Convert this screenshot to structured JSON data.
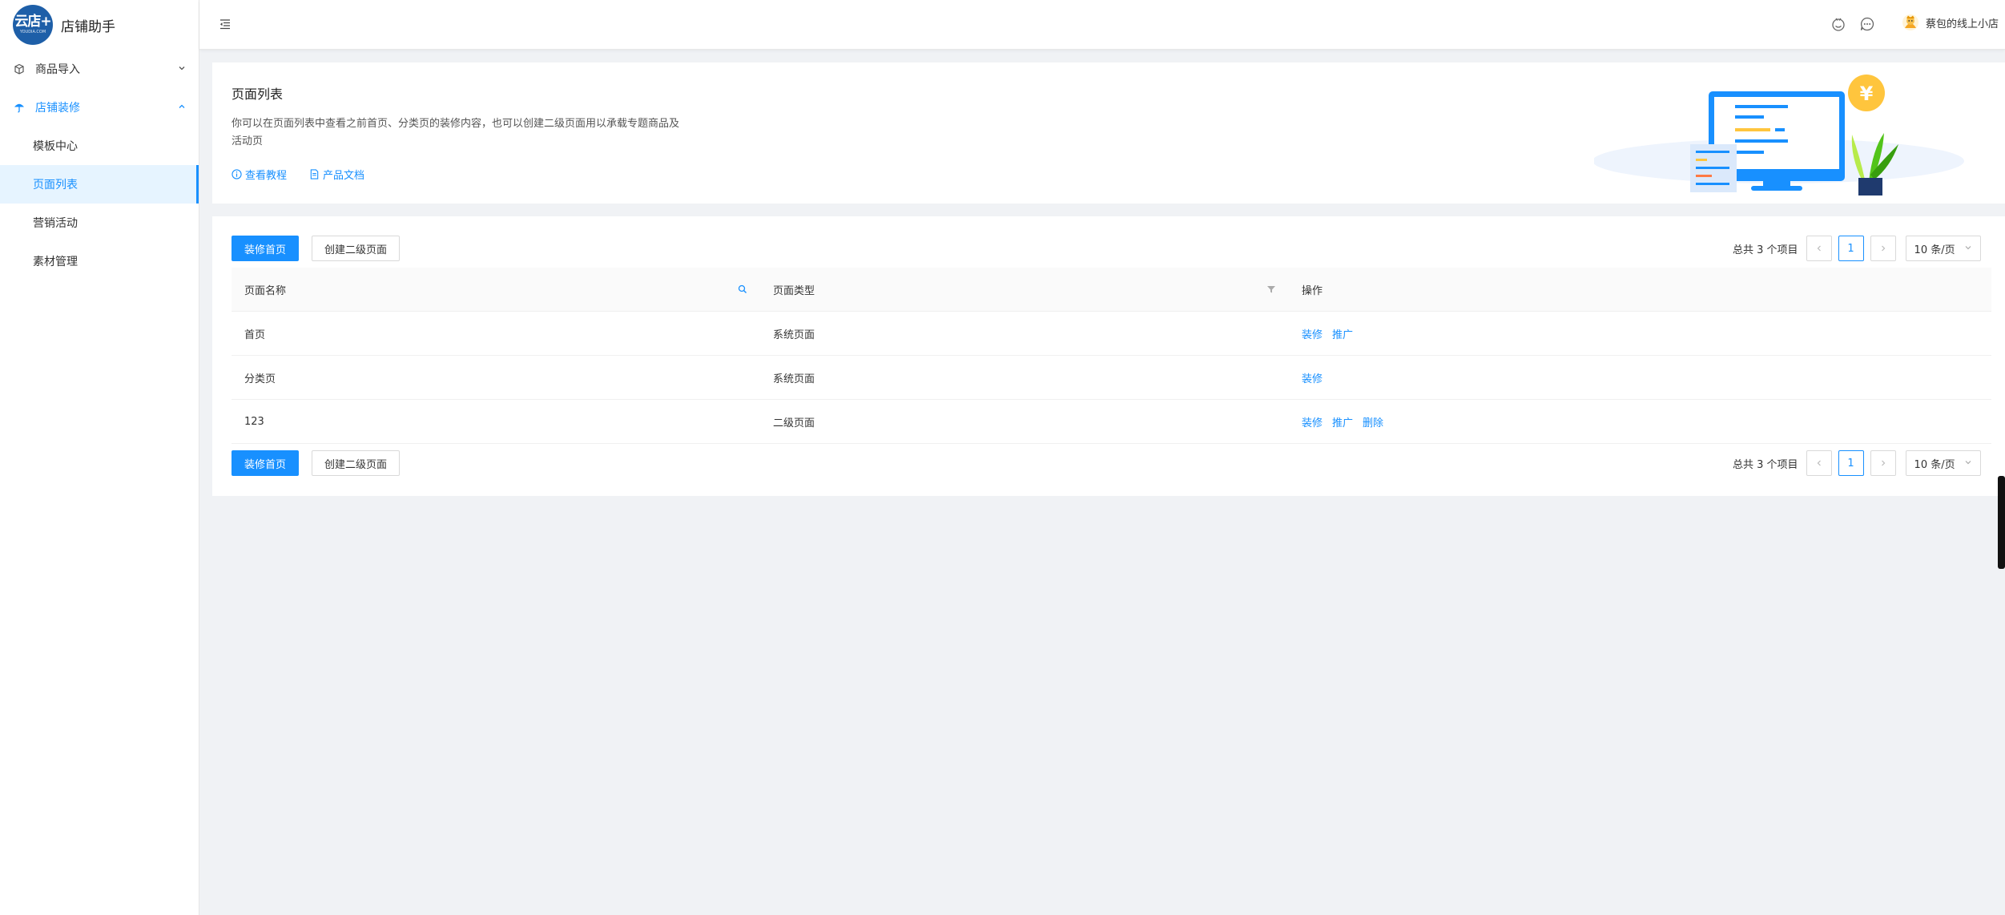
{
  "app": {
    "logo_text": "云店+",
    "logo_sub": "YOUDIA.COM",
    "title": "店铺助手"
  },
  "sidebar": {
    "groups": [
      {
        "label": "商品导入",
        "icon": "package-icon",
        "expanded": false
      },
      {
        "label": "店铺装修",
        "icon": "umbrella-icon",
        "expanded": true,
        "items": [
          {
            "label": "模板中心"
          },
          {
            "label": "页面列表",
            "selected": true
          },
          {
            "label": "营销活动"
          },
          {
            "label": "素材管理"
          }
        ]
      }
    ]
  },
  "header": {
    "collapse_icon": "menu-fold-icon",
    "icons": [
      "robot-icon",
      "message-icon"
    ],
    "user_name": "蔡包的线上小店"
  },
  "intro": {
    "title": "页面列表",
    "description": "你可以在页面列表中查看之前首页、分类页的装修内容，也可以创建二级页面用以承载专题商品及活动页",
    "links": [
      {
        "label": "查看教程",
        "icon": "info-circle-icon"
      },
      {
        "label": "产品文档",
        "icon": "file-icon"
      }
    ]
  },
  "toolbar": {
    "primary_label": "装修首页",
    "secondary_label": "创建二级页面"
  },
  "pagination": {
    "total_text": "总共 3 个项目",
    "current_page": "1",
    "page_size": "10 条/页",
    "prev_icon": "chevron-left-icon",
    "next_icon": "chevron-right-icon"
  },
  "table": {
    "columns": [
      {
        "label": "页面名称",
        "icon": "search-icon"
      },
      {
        "label": "页面类型",
        "icon": "filter-icon"
      },
      {
        "label": "操作"
      }
    ],
    "rows": [
      {
        "name": "首页",
        "type": "系统页面",
        "actions": [
          "装修",
          "推广"
        ]
      },
      {
        "name": "分类页",
        "type": "系统页面",
        "actions": [
          "装修"
        ]
      },
      {
        "name": "123",
        "type": "二级页面",
        "actions": [
          "装修",
          "推广",
          "删除"
        ]
      }
    ]
  },
  "colors": {
    "primary": "#1890ff",
    "logo_bg": "#1e5fa8",
    "page_bg": "#f0f2f5",
    "selected_bg": "#e6f4ff"
  }
}
